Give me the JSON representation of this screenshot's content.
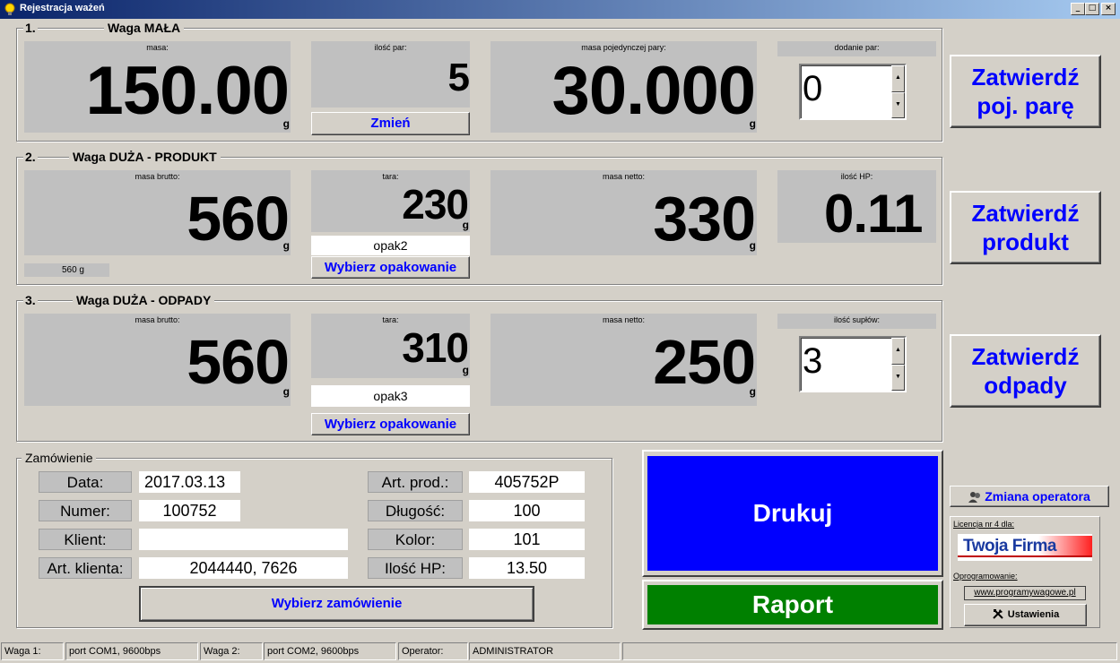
{
  "window": {
    "title": "Rejestracja ważeń",
    "min": "_",
    "max": "□",
    "close": "×"
  },
  "section1": {
    "num": "1.",
    "title": "Waga MAŁA",
    "masa_label": "masa:",
    "masa_value": "150.00",
    "masa_unit": "g",
    "ilosc_par_label": "ilość par:",
    "ilosc_par_value": "5",
    "zmien_label": "Zmień",
    "masa_pary_label": "masa pojedynczej pary:",
    "masa_pary_value": "30.000",
    "masa_pary_unit": "g",
    "dodanie_label": "dodanie par:",
    "dodanie_value": "0",
    "confirm_label_1": "Zatwierdź",
    "confirm_label_2": "poj. parę"
  },
  "section2": {
    "num": "2.",
    "title": "Waga DUŻA - PRODUKT",
    "brutto_label": "masa brutto:",
    "brutto_value": "560",
    "brutto_unit": "g",
    "brutto_small": "560 g",
    "tara_label": "tara:",
    "tara_value": "230",
    "tara_unit": "g",
    "opak_value": "opak2",
    "wybierz_label": "Wybierz opakowanie",
    "netto_label": "masa netto:",
    "netto_value": "330",
    "netto_unit": "g",
    "hp_label": "ilość HP:",
    "hp_value": "0.11",
    "confirm_label_1": "Zatwierdź",
    "confirm_label_2": "produkt"
  },
  "section3": {
    "num": "3.",
    "title": "Waga DUŻA - ODPADY",
    "brutto_label": "masa brutto:",
    "brutto_value": "560",
    "brutto_unit": "g",
    "tara_label": "tara:",
    "tara_value": "310",
    "tara_unit": "g",
    "opak_value": "opak3",
    "wybierz_label": "Wybierz opakowanie",
    "netto_label": "masa netto:",
    "netto_value": "250",
    "netto_unit": "g",
    "suplow_label": "ilość supłów:",
    "suplow_value": "3",
    "confirm_label_1": "Zatwierdź",
    "confirm_label_2": "odpady"
  },
  "order": {
    "title": "Zamówienie",
    "data_label": "Data:",
    "data_value": "2017.03.13",
    "numer_label": "Numer:",
    "numer_value": "100752",
    "klient_label": "Klient:",
    "klient_value": "",
    "art_klienta_label": "Art. klienta:",
    "art_klienta_value": "2044440, 7626",
    "art_prod_label": "Art. prod.:",
    "art_prod_value": "405752P",
    "dlugosc_label": "Długość:",
    "dlugosc_value": "100",
    "kolor_label": "Kolor:",
    "kolor_value": "101",
    "ilosc_hp_label": "Ilość HP:",
    "ilosc_hp_value": "13.50",
    "wybierz_label": "Wybierz zamówienie"
  },
  "actions": {
    "drukuj": "Drukuj",
    "raport": "Raport"
  },
  "side": {
    "zmiana_operatora": "Zmiana operatora",
    "licencja_label": "Licencja nr 4 dla:",
    "logo_text": "Twoja Firma",
    "oprogramowanie_label": "Oprogramowanie:",
    "www": "www.programywagowe.pl",
    "ustawienia": "Ustawienia"
  },
  "status": {
    "waga1_label": "Waga 1:",
    "waga1_value": "port COM1, 9600bps",
    "waga2_label": "Waga 2:",
    "waga2_value": "port COM2, 9600bps",
    "operator_label": "Operator:",
    "operator_value": "ADMINISTRATOR"
  },
  "colors": {
    "drukuj": "#0000ff",
    "raport": "#008000",
    "accent_text": "#0000ff",
    "panel": "#c0c0c0"
  }
}
